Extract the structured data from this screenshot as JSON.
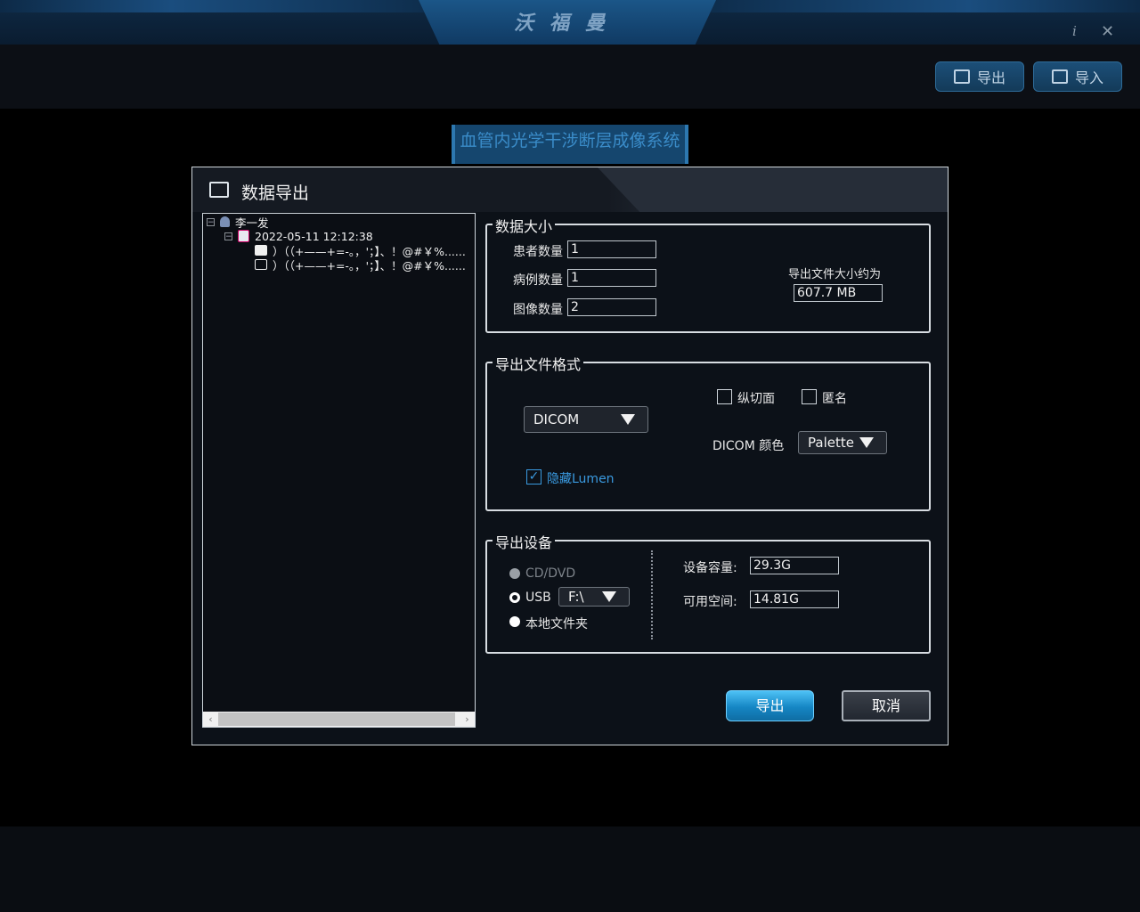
{
  "app": {
    "brand": "沃福曼",
    "system_title": "血管内光学干涉断层成像系统"
  },
  "toolbar": {
    "export_label": "导出",
    "import_label": "导入"
  },
  "dialog": {
    "title": "数据导出",
    "tree": {
      "patient": "李一发",
      "study": "2022-05-11 12:12:38",
      "items": [
        "）（（+——+=-。，'；】、！@#￥%......",
        "）（（+——+=-。，'；】、！@#￥%......"
      ]
    },
    "data_size": {
      "legend": "数据大小",
      "patient_count_label": "患者数量",
      "patient_count": "1",
      "case_count_label": "病例数量",
      "case_count": "1",
      "image_count_label": "图像数量",
      "image_count": "2",
      "file_size_label": "导出文件大小约为",
      "file_size": "607.7 MB"
    },
    "format": {
      "legend": "导出文件格式",
      "format_value": "DICOM",
      "longitudinal_label": "纵切面",
      "longitudinal_checked": false,
      "anonymous_label": "匿名",
      "anonymous_checked": false,
      "dicom_color_label": "DICOM 颜色",
      "dicom_color_value": "Palette",
      "hide_lumen_label": "隐藏Lumen",
      "hide_lumen_checked": true
    },
    "device": {
      "legend": "导出设备",
      "options": [
        "CD/DVD",
        "USB",
        "本地文件夹"
      ],
      "selected": "USB",
      "usb_drive": "F:\\",
      "capacity_label": "设备容量:",
      "capacity": "29.3G",
      "free_label": "可用空间:",
      "free": "14.81G"
    },
    "buttons": {
      "export": "导出",
      "cancel": "取消"
    }
  },
  "colors": {
    "accent": "#1586c4",
    "checkbox_accent": "#3a9ae0",
    "lumen_text": "#3a9ae0"
  }
}
